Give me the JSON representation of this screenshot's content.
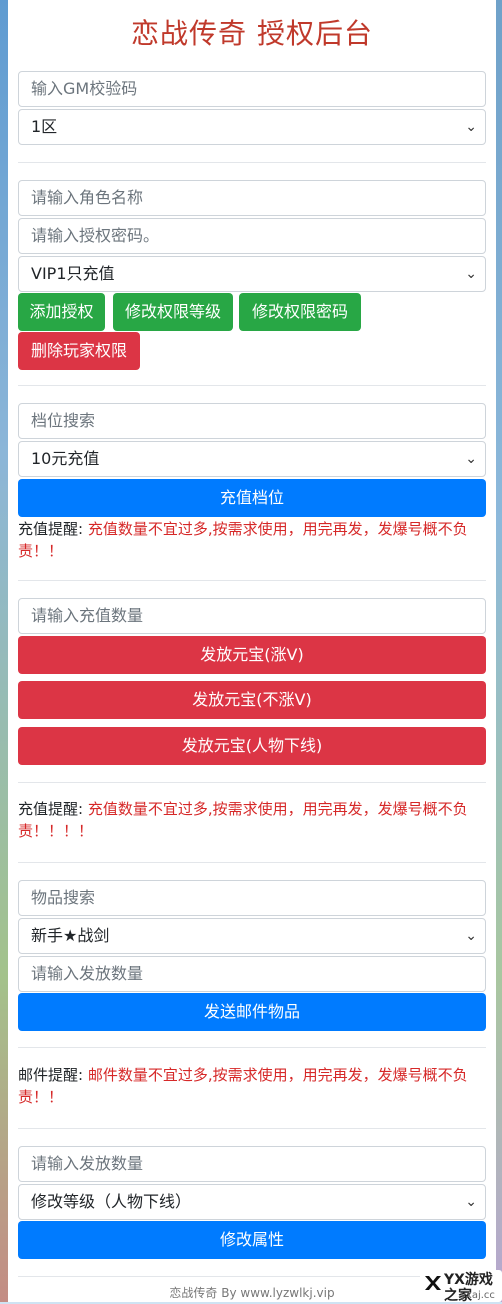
{
  "title": "恋战传奇 授权后台",
  "gm": {
    "code_placeholder": "输入GM校验码",
    "server_selected": "1区"
  },
  "auth": {
    "role_placeholder": "请输入角色名称",
    "password_placeholder": "请输入授权密码。",
    "vip_selected": "VIP1只充值",
    "add_label": "添加授权",
    "modify_level_label": "修改权限等级",
    "modify_password_label": "修改权限密码",
    "delete_label": "删除玩家权限"
  },
  "recharge": {
    "search_placeholder": "档位搜索",
    "tier_selected": "10元充值",
    "button_label": "充值档位",
    "note_prefix": "充值提醒: ",
    "note_text": "充值数量不宜过多,按需求使用，用完再发，发爆号概不负责！！"
  },
  "ingot": {
    "amount_placeholder": "请输入充值数量",
    "btn1": "发放元宝(涨V)",
    "btn2": "发放元宝(不涨V)",
    "btn3": "发放元宝(人物下线)",
    "note_prefix": "充值提醒: ",
    "note_text": "充值数量不宜过多,按需求使用，用完再发，发爆号概不负责！！！！"
  },
  "items": {
    "search_placeholder": "物品搜索",
    "item_selected": "新手★战剑",
    "amount_placeholder": "请输入发放数量",
    "button_label": "发送邮件物品",
    "note_prefix": "邮件提醒: ",
    "note_text": "邮件数量不宜过多,按需求使用，用完再发，发爆号概不负责！！"
  },
  "attr": {
    "amount_placeholder": "请输入发放数量",
    "type_selected": "修改等级（人物下线）",
    "button_label": "修改属性"
  },
  "footer": "恋战传奇 By www.lyzwlkj.vip",
  "watermark": {
    "line1": "YX游戏之家",
    "line2": "yxaj.cc"
  }
}
